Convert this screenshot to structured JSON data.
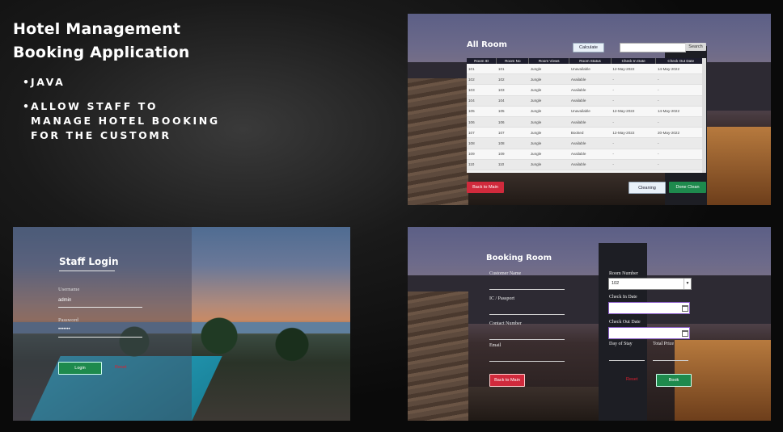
{
  "header": {
    "title_line1": "Hotel Management",
    "title_line2": "Booking Application",
    "bullets": [
      "JAVA",
      "ALLOW STAFF TO\nMANAGE HOTEL BOOKING\nFOR THE CUSTOMR"
    ]
  },
  "all_room": {
    "heading": "All Room",
    "calculate_label": "Calculate",
    "search_value": "",
    "search_label": "Search",
    "columns": [
      "Room ID",
      "Room No",
      "Room Views",
      "Room Status",
      "Check In Date",
      "Check Out Date"
    ],
    "rows": [
      [
        "101",
        "101",
        "Jungle",
        "Unavailable",
        "12-May-2022",
        "14-May-2022"
      ],
      [
        "102",
        "102",
        "Jungle",
        "Available",
        "-",
        "-"
      ],
      [
        "103",
        "103",
        "Jungle",
        "Available",
        "-",
        "-"
      ],
      [
        "104",
        "104",
        "Jungle",
        "Available",
        "-",
        "-"
      ],
      [
        "105",
        "105",
        "Jungle",
        "Unavailable",
        "12-May-2022",
        "14-May-2022"
      ],
      [
        "106",
        "106",
        "Jungle",
        "Available",
        "-",
        "-"
      ],
      [
        "107",
        "107",
        "Jungle",
        "Booked",
        "12-May-2022",
        "20-May-2022"
      ],
      [
        "108",
        "108",
        "Jungle",
        "Available",
        "-",
        "-"
      ],
      [
        "109",
        "109",
        "Jungle",
        "Available",
        "-",
        "-"
      ],
      [
        "110",
        "110",
        "Jungle",
        "Available",
        "-",
        "-"
      ]
    ],
    "back_label": "Back to Main",
    "cleaning_label": "Cleaning",
    "done_clean_label": "Done Clean"
  },
  "login": {
    "heading": "Staff Login",
    "username_label": "Username",
    "username_value": "admin",
    "password_label": "Password",
    "password_value": "•••••••",
    "login_label": "Login",
    "reset_label": "Reset"
  },
  "booking": {
    "heading": "Booking Room",
    "customer_name_label": "Customer Name",
    "ic_label": "IC / Passport",
    "contact_label": "Contact Number",
    "email_label": "Email",
    "room_number_label": "Room Number",
    "room_number_value": "102",
    "check_in_label": "Check In Date",
    "check_out_label": "Check Out Date",
    "day_of_stay_label": "Day of Stay",
    "total_price_label": "Total Price",
    "reset_label": "Reset",
    "back_label": "Back to Main",
    "book_label": "Book"
  },
  "colors": {
    "red_button": "#d02a3c",
    "green_button": "#1e8a4d",
    "table_header": "#1c1c2c"
  }
}
